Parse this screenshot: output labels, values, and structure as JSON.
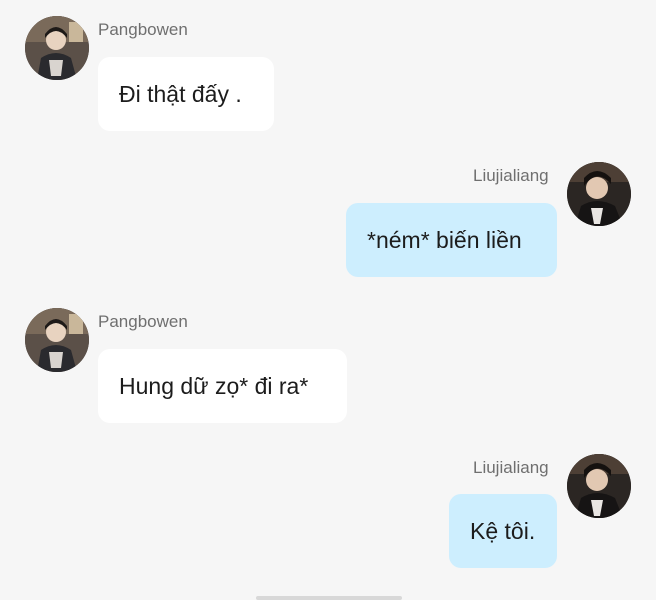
{
  "colors": {
    "background": "#f6f6f6",
    "incoming_bubble": "#ffffff",
    "outgoing_bubble": "#cdeefe",
    "sender_text": "#6f6f6f",
    "message_text": "#1c1c1c"
  },
  "messages": [
    {
      "sender": "Pangbowen",
      "text": "Đi thật đấy .",
      "direction": "incoming",
      "avatar": "photo-avatar"
    },
    {
      "sender": "Liujialiang",
      "text": "*ném* biến liền",
      "direction": "outgoing",
      "avatar": "photo-avatar"
    },
    {
      "sender": "Pangbowen",
      "text": "Hung dữ zọ* đi ra*",
      "direction": "incoming",
      "avatar": "photo-avatar"
    },
    {
      "sender": "Liujialiang",
      "text": "Kệ tôi.",
      "direction": "outgoing",
      "avatar": "photo-avatar"
    }
  ]
}
